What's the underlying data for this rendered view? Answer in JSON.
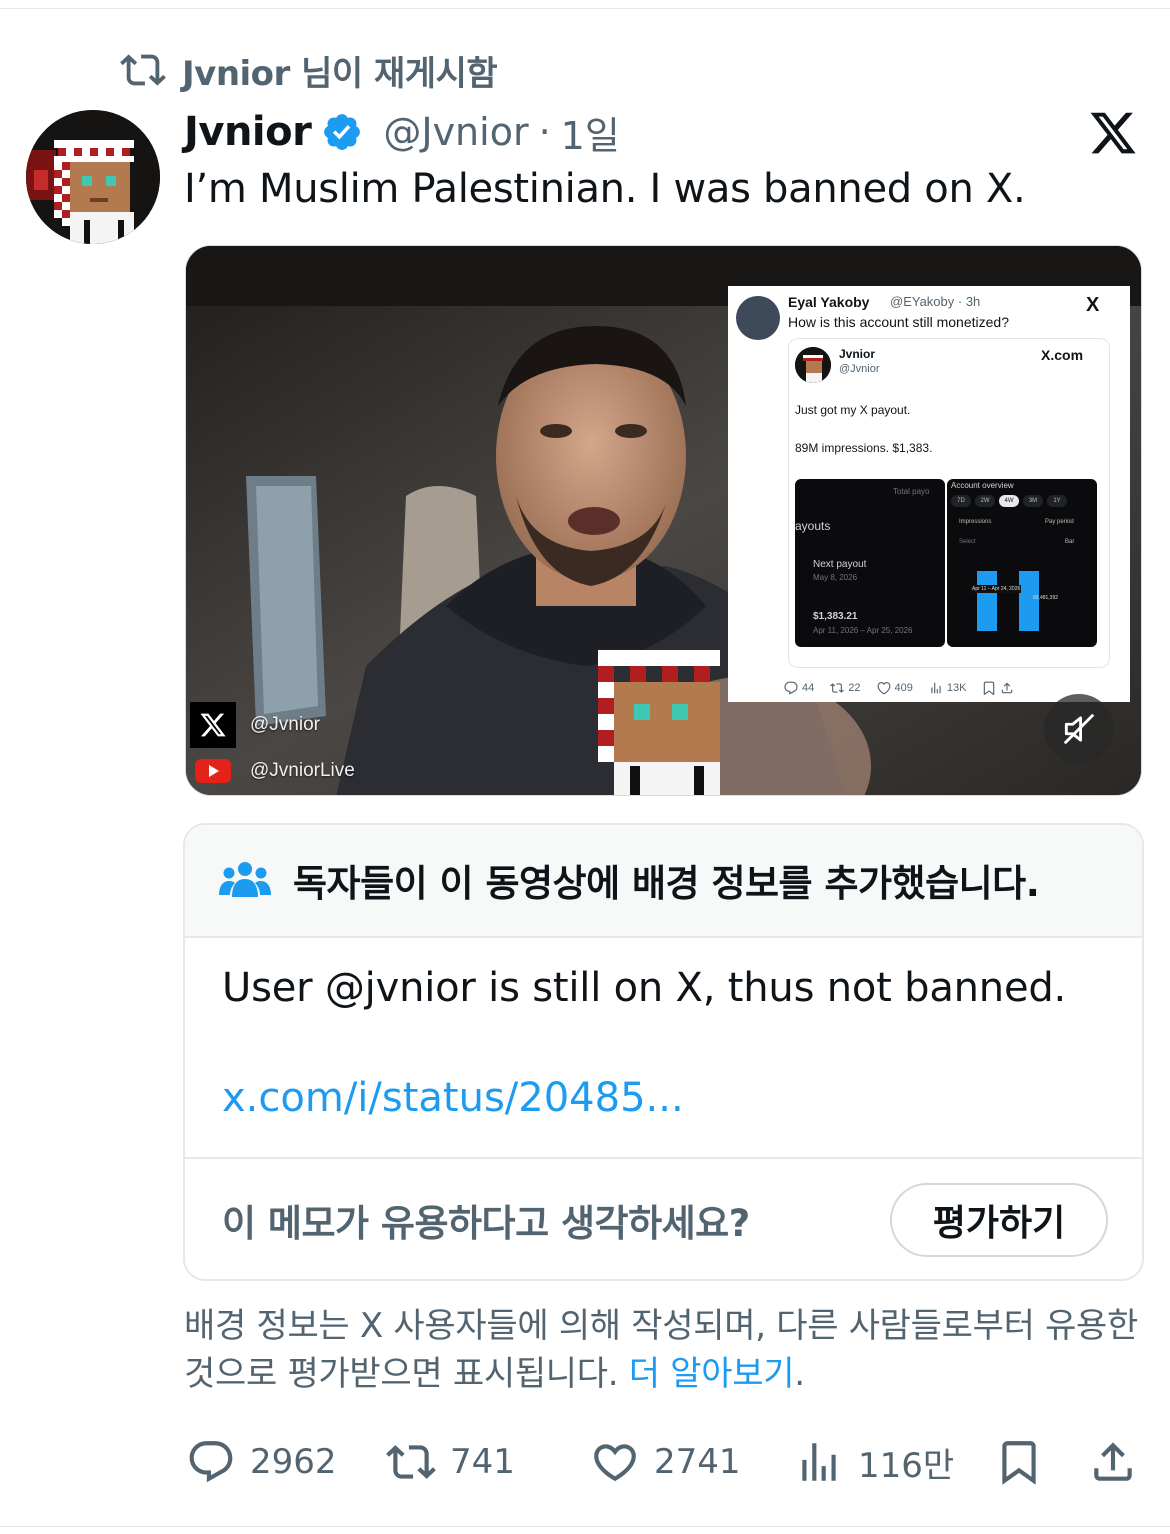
{
  "repost": {
    "label": "Jvnior 님이 재게시함",
    "icon": "repost-icon"
  },
  "tweet": {
    "author_name": "Jvnior",
    "verified": true,
    "handle": "@Jvnior",
    "separator": "·",
    "age": "1일",
    "text": "I’m Muslim Palestinian. I was banned on X.",
    "platform_logo": "x-logo"
  },
  "video": {
    "overlay": {
      "x_handle": "@Jvnior",
      "youtube_handle": "@JvniorLive"
    },
    "mute_icon": "muted-speaker-icon",
    "embedded_post": {
      "name": "Eyal Yakoby",
      "handle_time": "@EYakoby · 3h",
      "text": "How is this account still monetized?",
      "logo": "X",
      "quote": {
        "name": "Jvnior",
        "handle": "@Jvnior",
        "site": "X.com",
        "line1": "Just got my X payout.",
        "line2": "89M impressions. $1,383.",
        "left_panel": {
          "total": "Total payo",
          "payouts": "ayouts",
          "next_payout": "Next payout",
          "next_date": "May 8, 2026",
          "amount": "$1,383.21",
          "range": "Apr 11, 2026 – Apr 25, 2026"
        },
        "right_panel": {
          "title": "Account overview",
          "ranges": [
            "7D",
            "2W",
            "4W",
            "3M",
            "1Y"
          ],
          "active_range": "4W",
          "metric": "Impressions",
          "period": "Pay period",
          "select": "Select",
          "bar": "Bar",
          "range_label": "Apr 11 – Apr 24, 2026",
          "value_label": "89,481,392"
        }
      },
      "stats": {
        "replies": "44",
        "reposts": "22",
        "likes": "409",
        "views": "13K"
      }
    }
  },
  "community_note": {
    "header_icon": "people-icon",
    "title": "독자들이 이 동영상에 배경 정보를 추가했습니다.",
    "body": "User @jvnior is still on X, thus not banned.",
    "link": "x.com/i/status/20485...",
    "rate_question": "이 메모가 유용하다고 생각하세요?",
    "rate_button": "평가하기"
  },
  "disclaimer": {
    "text": "배경 정보는 X 사용자들에 의해 작성되며, 다른 사람들로부터 유용한 것으로 평가받으면 표시됩니다.",
    "learn_more": "더 알아보기",
    "end": "."
  },
  "actions": {
    "replies": "2962",
    "reposts": "741",
    "likes": "2741",
    "views": "116만"
  },
  "colors": {
    "accent": "#1d9bf0",
    "text_primary": "#0f1419",
    "text_secondary": "#536471",
    "border": "#e6e8ea"
  }
}
